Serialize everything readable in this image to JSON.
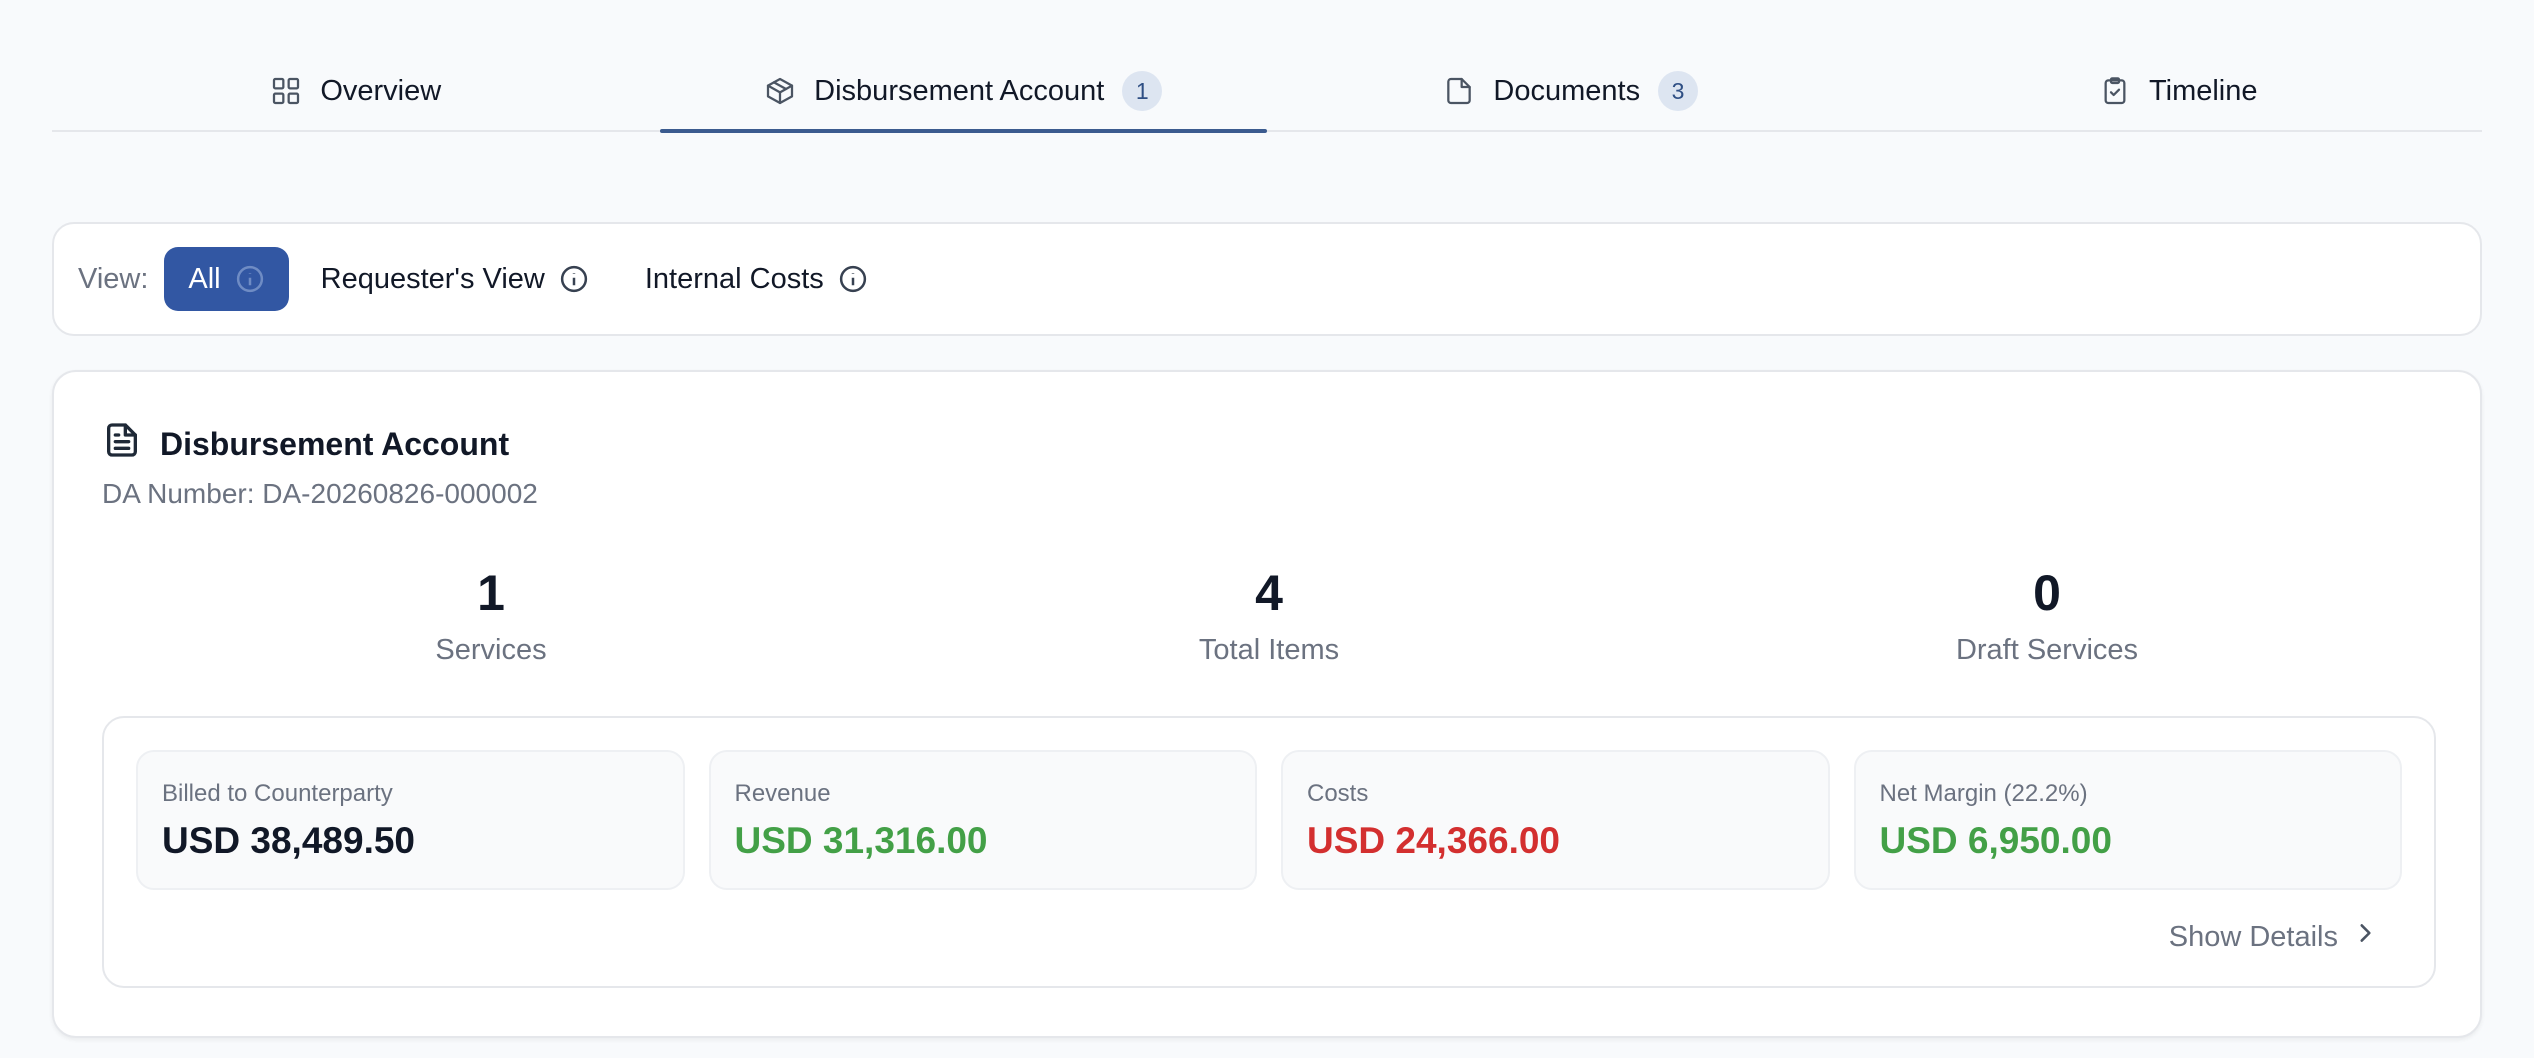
{
  "tabs": [
    {
      "label": "Overview",
      "icon": "grid-icon",
      "badge": null
    },
    {
      "label": "Disbursement Account",
      "icon": "box-icon",
      "badge": "1",
      "active": true
    },
    {
      "label": "Documents",
      "icon": "file-icon",
      "badge": "3"
    },
    {
      "label": "Timeline",
      "icon": "clipboard-check-icon",
      "badge": null
    }
  ],
  "view": {
    "label": "View:",
    "options": [
      {
        "label": "All",
        "active": true
      },
      {
        "label": "Requester's View"
      },
      {
        "label": "Internal Costs"
      }
    ]
  },
  "card": {
    "title": "Disbursement Account",
    "da_number": "DA Number: DA-20260826-000002",
    "stats": [
      {
        "value": "1",
        "label": "Services"
      },
      {
        "value": "4",
        "label": "Total Items"
      },
      {
        "value": "0",
        "label": "Draft Services"
      }
    ],
    "financials": [
      {
        "label": "Billed to Counterparty",
        "value": "USD 38,489.50",
        "color": "#111827"
      },
      {
        "label": "Revenue",
        "value": "USD 31,316.00",
        "color": "#43a047"
      },
      {
        "label": "Costs",
        "value": "USD 24,366.00",
        "color": "#d32f2f"
      },
      {
        "label": "Net Margin (22.2%)",
        "value": "USD 6,950.00",
        "color": "#43a047"
      }
    ],
    "show_details": "Show Details"
  },
  "colors": {
    "accent": "#3257a3",
    "tab_underline": "#3b5b8f",
    "positive": "#43a047",
    "negative": "#d32f2f"
  }
}
